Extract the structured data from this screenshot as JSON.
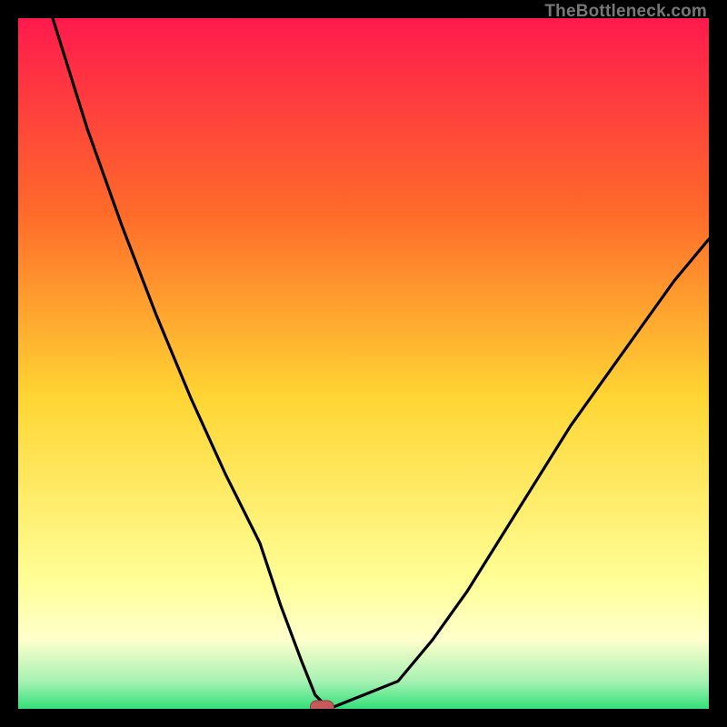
{
  "watermark": "TheBottleneck.com",
  "colors": {
    "background_black": "#000000",
    "gradient_top": "#ff1a4d",
    "gradient_mid1": "#ff6a2a",
    "gradient_mid2": "#ffd633",
    "gradient_low": "#ffff99",
    "gradient_green": "#33e07a",
    "curve_stroke": "#000000",
    "marker_fill": "#c45a5a",
    "marker_stroke": "#8a3c3c"
  },
  "chart_data": {
    "type": "line",
    "title": "",
    "xlabel": "",
    "ylabel": "",
    "xlim": [
      0,
      100
    ],
    "ylim": [
      0,
      100
    ],
    "grid": false,
    "legend": false,
    "series": [
      {
        "name": "curve",
        "x": [
          5,
          10,
          15,
          20,
          25,
          30,
          35,
          38,
          41,
          43,
          45,
          55,
          60,
          65,
          70,
          75,
          80,
          85,
          90,
          95,
          100
        ],
        "y": [
          100,
          84,
          70,
          57,
          45,
          34,
          24,
          15,
          7,
          2,
          0,
          4,
          10,
          17,
          25,
          33,
          41,
          48,
          55,
          62,
          68
        ]
      }
    ],
    "marker": {
      "x": 44,
      "y": 0,
      "shape": "pill"
    },
    "gradient_stops": [
      {
        "pos": 0.0,
        "color": "#ff1a4d"
      },
      {
        "pos": 0.28,
        "color": "#ff6a2a"
      },
      {
        "pos": 0.55,
        "color": "#ffd633"
      },
      {
        "pos": 0.82,
        "color": "#ffff99"
      },
      {
        "pos": 0.9,
        "color": "#ffffcc"
      },
      {
        "pos": 0.96,
        "color": "#a7f2b3"
      },
      {
        "pos": 1.0,
        "color": "#33e07a"
      }
    ]
  }
}
